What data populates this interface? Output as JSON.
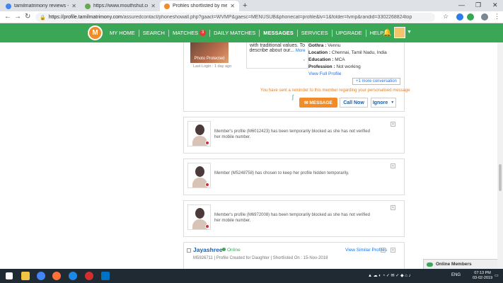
{
  "browser": {
    "tabs": [
      {
        "title": "tamilmatrimony reviews - Google",
        "icon_color": "#4285f4"
      },
      {
        "title": "https://www.mouthshut.com/mi",
        "icon_color": "#6aa84f"
      },
      {
        "title": "Profiles shortlisted by me",
        "icon_color": "#f28c28"
      }
    ],
    "new_tab": "+",
    "url_host": "https://profile.tamilmatrimony.com",
    "url_path": "/assuredcontact/phoneshowall.php?gaact=WVMP&gaesc=MENUSUB&phonecat=profile&lv=1&folder=lvmp&randid=3302268824top"
  },
  "header": {
    "logo_letter": "M",
    "nav": [
      {
        "label": "MY HOME",
        "active": false
      },
      {
        "label": "SEARCH",
        "active": false
      },
      {
        "label": "MATCHES",
        "active": false,
        "badge": "3"
      },
      {
        "label": "DAILY MATCHES",
        "active": false
      },
      {
        "label": "MESSAGES",
        "active": true
      },
      {
        "label": "SERVICES",
        "active": false
      },
      {
        "label": "UPGRADE",
        "active": false
      },
      {
        "label": "HELP",
        "active": false
      }
    ],
    "brand_color": "#3aa757"
  },
  "card1": {
    "photo_label": "Photo Protected",
    "last_login": "Last Login : 1 day ago",
    "quote_text": "with traditional values. To describe about our...",
    "quote_more": "More",
    "gothra_label": "Gothra :",
    "gothra_value": "Vennu",
    "location_label": "Location :",
    "location_value": "Chennai, Tamil Nadu, India",
    "education_label": "Education :",
    "education_value": "MCA",
    "profession_label": "Profession :",
    "profession_value": "Not working",
    "view_profile": "View Full Profile",
    "more_conversation": "+1 more conversation",
    "reminder": "You have sent a reminder to this member regarding your personalised message",
    "message_btn": "MESSAGE",
    "call_btn": "Call Now",
    "ignore_btn": "Ignore"
  },
  "blocked_cards": [
    {
      "message": "Member's profile (M6012423) has been temporarily blocked as she has not verified her mobile number."
    },
    {
      "message": "Member (M5248758) has chosen to keep her profile hidden temporarily."
    },
    {
      "message": "Member's profile (M6972008) has been temporarily blocked as she has not verified her mobile number."
    }
  ],
  "jayashree": {
    "name": "Jayashree",
    "status": "Online",
    "similar": "View Similar Profiles",
    "meta": "M5926711 | Profile Created for Daughter | Shortlisted On : 15-Nov-2018"
  },
  "online_members": "Online Members",
  "taskbar": {
    "lang": "ENG",
    "time": "07:13 PM",
    "date": "03-02-2019"
  }
}
